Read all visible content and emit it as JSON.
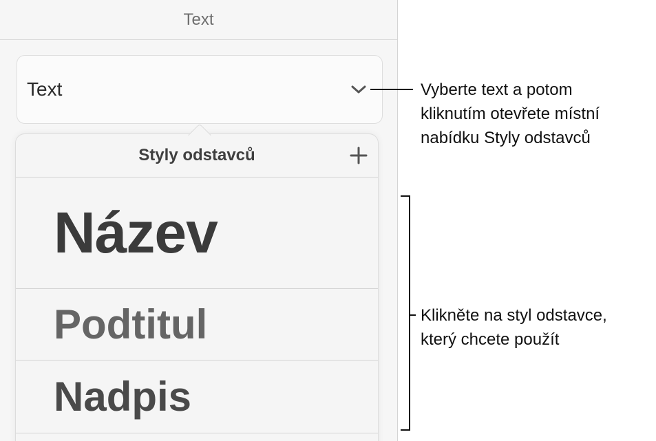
{
  "panel": {
    "header_title": "Text",
    "style_selector": {
      "label": "Text",
      "icon": "chevron-down-icon"
    }
  },
  "popover": {
    "title": "Styly odstavců",
    "add_icon": "plus-icon",
    "styles": [
      {
        "label": "Název"
      },
      {
        "label": "Podtitul"
      },
      {
        "label": "Nadpis"
      }
    ]
  },
  "callouts": {
    "selector": [
      "Vyberte text a potom",
      "kliknutím otevřete místní",
      "nabídku Styly odstavců"
    ],
    "styles": [
      "Klikněte na styl odstavce,",
      "který chcete použít"
    ]
  }
}
